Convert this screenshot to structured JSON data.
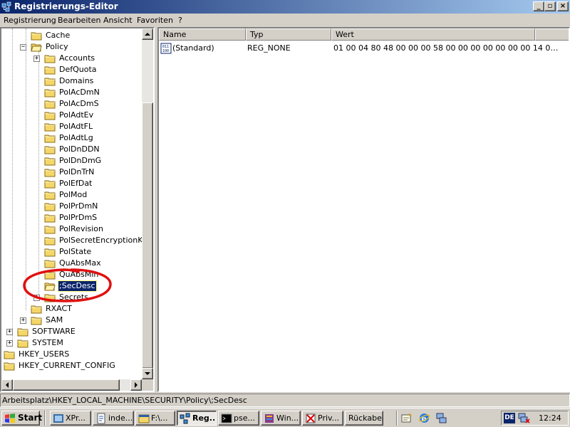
{
  "window": {
    "title": "Registrierungs-Editor",
    "min_glyph": "_",
    "max_glyph": "▫",
    "close_glyph": "×"
  },
  "menu": [
    "Registrierung",
    "Bearbeiten",
    "Ansicht",
    "Favoriten",
    "?"
  ],
  "tree": {
    "policy_children": [
      "Accounts",
      "DefQuota",
      "Domains",
      "PolAcDmN",
      "PolAcDmS",
      "PolAdtEv",
      "PolAdtFL",
      "PolAdtLg",
      "PolDnDDN",
      "PolDnDmG",
      "PolDnTrN",
      "PolEfDat",
      "PolMod",
      "PolPrDmN",
      "PolPrDmS",
      "PolRevision",
      "PolSecretEncryptionKey",
      "PolState",
      "QuAbsMax",
      "QuAbsMin",
      ";SecDesc",
      "Secrets"
    ],
    "selected": ";SecDesc",
    "cache": "Cache",
    "policy": "Policy",
    "rxact": "RXACT",
    "sam": "SAM",
    "software": "SOFTWARE",
    "system": "SYSTEM",
    "hkey_users": "HKEY_USERS",
    "hkey_current_config": "HKEY_CURRENT_CONFIG",
    "expand_plus": "+",
    "expand_minus": "−"
  },
  "list": {
    "columns": [
      "Name",
      "Typ",
      "Wert"
    ],
    "rows": [
      {
        "name": "(Standard)",
        "type": "REG_NONE",
        "value": "01 00 04 80 48 00 00 00 58 00 00 00 00 00 00 00 14 0…",
        "icon": "binary-value-icon"
      }
    ]
  },
  "statusbar": {
    "path": "Arbeitsplatz\\HKEY_LOCAL_MACHINE\\SECURITY\\Policy\\;SecDesc"
  },
  "taskbar": {
    "start": "Start",
    "tasks": [
      {
        "label": "XPr...",
        "icon": "xp-app-icon"
      },
      {
        "label": "inde...",
        "icon": "notepad-icon"
      },
      {
        "label": "F:\\...",
        "icon": "folder-window-icon"
      },
      {
        "label": "Reg...",
        "icon": "regedit-icon",
        "active": true
      },
      {
        "label": "pse...",
        "icon": "console-icon"
      },
      {
        "label": "Win...",
        "icon": "winrar-icon"
      },
      {
        "label": "Priv...",
        "icon": "privacy-tool-icon"
      },
      {
        "label": "Rückaben",
        "icon": ""
      }
    ],
    "quicklaunch": [
      "show-desktop-icon",
      "internet-explorer-icon",
      "network-icon"
    ],
    "tray": {
      "language": "DE",
      "clock": "12:24"
    }
  },
  "colors": {
    "titlebar_start": "#0a246a",
    "titlebar_end": "#a6caf0",
    "selection": "#0a246a",
    "annotation": "#e01010",
    "window_face": "#d4d0c8"
  }
}
